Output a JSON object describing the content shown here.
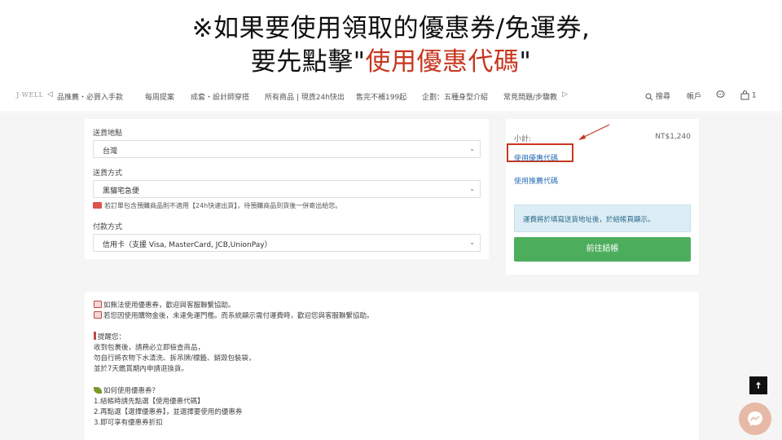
{
  "banner": {
    "line1": "※如果要使用領取的優惠券/免運券,",
    "line2_prefix": "要先點擊\"",
    "line2_highlight": "使用優惠代碼",
    "line2_suffix": "\""
  },
  "nav": {
    "logo": "J·WELL",
    "prev_arrow": "◁",
    "next_arrow": "▷",
    "items": [
      "品推薦・必買入手款",
      "每周提案",
      "成套・設計師穿搭",
      "所有商品 | 現貨24h快出",
      "售完不補199起",
      "企劃：五種身型介紹",
      "常見問題/步驟教"
    ],
    "search_label": "搜尋",
    "account_label": "帳戶",
    "cart_count": "1"
  },
  "shipping": {
    "region_label": "送貨地點",
    "region_value": "台灣",
    "method_label": "送貨方式",
    "method_value": "黑貓宅急便",
    "note": "若訂單包含預購商品則不適用【24h快速出貨】，待預購商品到貨後一併寄出給您。",
    "payment_label": "付款方式",
    "payment_value": "信用卡（支援 Visa, MasterCard, JCB,UnionPay）"
  },
  "summary": {
    "subtotal_label": "小計:",
    "subtotal_value": "NT$1,240",
    "coupon_link": "使用優惠代碼",
    "referral_link": "使用推薦代碼",
    "shipping_info": "運費將於填寫送貨地址後，於結帳頁顯示。",
    "checkout_button": "前往結帳"
  },
  "help": {
    "line1": "如無法使用優惠券，歡迎與客服聯繫協助。",
    "line2": "若您因使用購物金後，未達免運門檻。而系統顯示需付運費時，歡迎您與客服聯繫協助。",
    "reminder_title": "提醒您：",
    "reminder1": "收到包裹後，請務必立即檢查商品，",
    "reminder2": "勿自行將衣物下水清洗、拆吊牌/標籤、銷毀包裝袋，",
    "reminder3": "並於7天鑑賞期內申請退換貨。",
    "howto_title": "如何使用優惠券？",
    "step1": "1.結帳時請先點選【使用優惠代碼】",
    "step2": "2.再點選【選擇優惠券】，並選擇要使用的優惠券",
    "step3": "3.即可享有優惠券折扣"
  },
  "colors": {
    "highlight": "#c8361e",
    "link": "#2c6fb7",
    "checkout": "#4cae5c",
    "info_bg": "#dcedf5"
  }
}
